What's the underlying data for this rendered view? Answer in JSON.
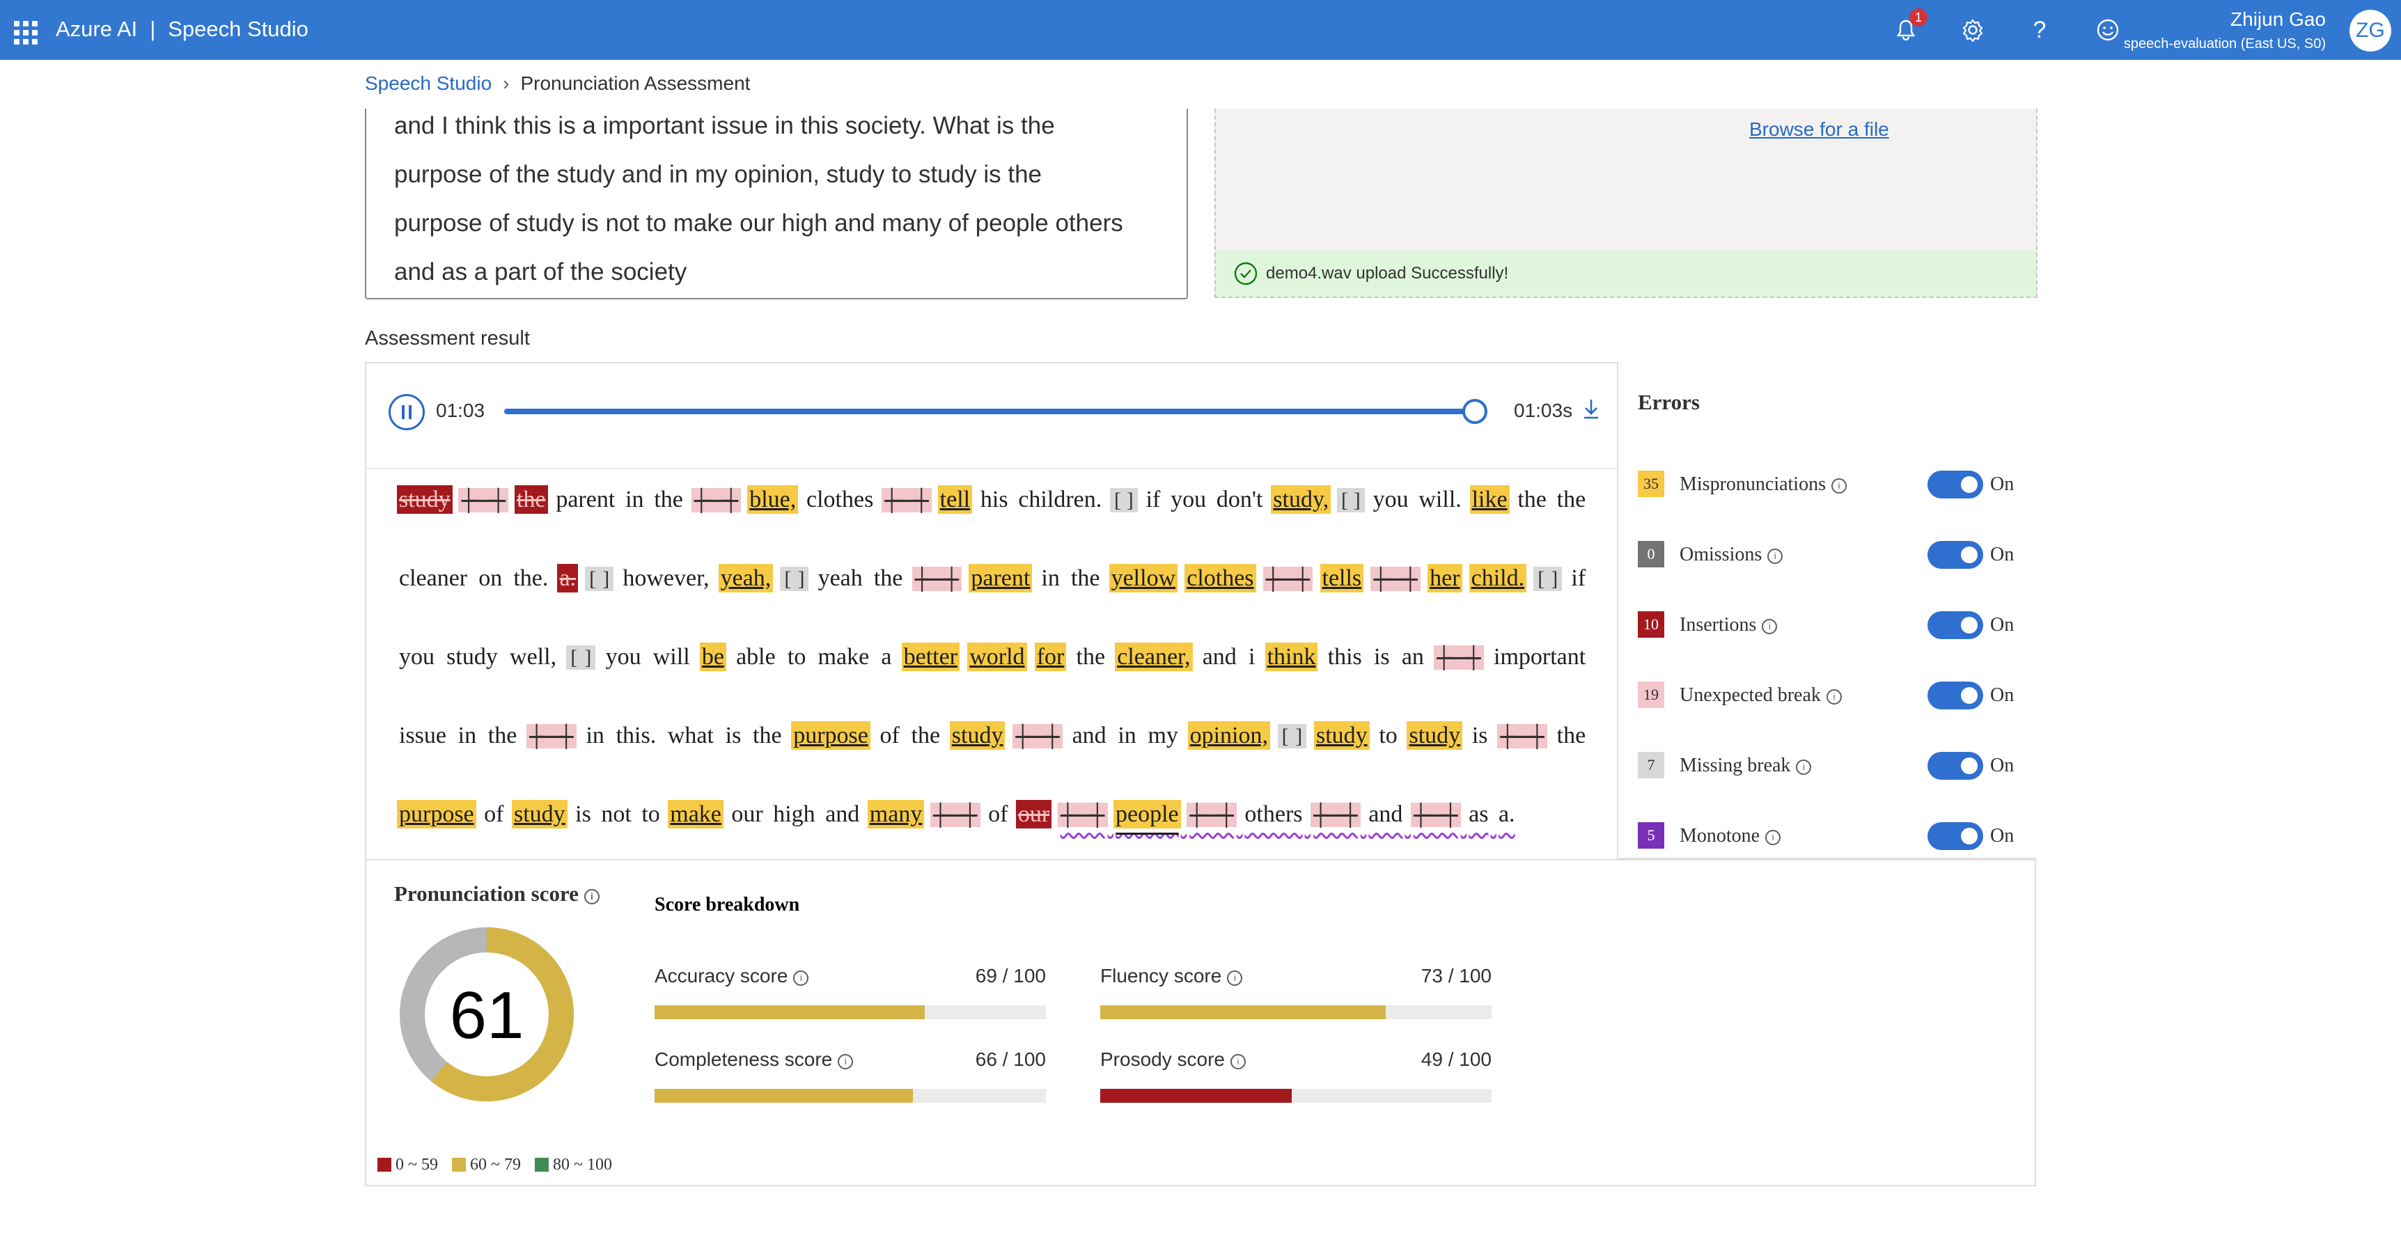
{
  "app": {
    "brand": "Azure AI",
    "product": "Speech Studio",
    "notification_count": "1",
    "user_name": "Zhijun Gao",
    "user_resource": "speech-evaluation (East US, S0)",
    "user_initials": "ZG"
  },
  "breadcrumb": {
    "root": "Speech Studio",
    "current": "Pronunciation Assessment"
  },
  "reference_text": {
    "lines": [
      "and I think this is a important issue in this society. What is the",
      "purpose of the study and in my opinion, study to study is the",
      "purpose of study is not to make our high and many of people others",
      "and as a part of the society"
    ]
  },
  "upload": {
    "browse_label": "Browse for a file",
    "status": "demo4.wav upload Successfully!"
  },
  "assessment": {
    "section_title": "Assessment result",
    "time_current": "01:03",
    "time_total": "01:03s",
    "playback_progress": 1.0
  },
  "transcript": [
    {
      "t": "study",
      "k": "ins"
    },
    {
      "t": "",
      "k": "ub"
    },
    {
      "t": "the",
      "k": "ins"
    },
    {
      "t": "parent",
      "k": "n"
    },
    {
      "t": "in",
      "k": "n"
    },
    {
      "t": "the",
      "k": "n"
    },
    {
      "t": "",
      "k": "ub"
    },
    {
      "t": "blue,",
      "k": "mis"
    },
    {
      "t": "clothes",
      "k": "n"
    },
    {
      "t": "",
      "k": "ub"
    },
    {
      "t": "tell",
      "k": "mis"
    },
    {
      "t": "his",
      "k": "n"
    },
    {
      "t": "children.",
      "k": "n"
    },
    {
      "t": "[ ]",
      "k": "mb"
    },
    {
      "t": "if",
      "k": "n"
    },
    {
      "t": "you",
      "k": "n"
    },
    {
      "t": "don't",
      "k": "n"
    },
    {
      "t": "study,",
      "k": "mis"
    },
    {
      "t": "[ ]",
      "k": "mb"
    },
    {
      "t": "you",
      "k": "n"
    },
    {
      "t": "will.",
      "k": "n"
    },
    {
      "t": "like",
      "k": "mis"
    },
    {
      "t": "the",
      "k": "n"
    },
    {
      "t": "the",
      "k": "n"
    },
    {
      "t": "cleaner",
      "k": "n"
    },
    {
      "t": "on",
      "k": "n"
    },
    {
      "t": "the.",
      "k": "n"
    },
    {
      "t": "a.",
      "k": "ins"
    },
    {
      "t": "[ ]",
      "k": "mb"
    },
    {
      "t": "however,",
      "k": "n"
    },
    {
      "t": "yeah,",
      "k": "mis"
    },
    {
      "t": "[ ]",
      "k": "mb"
    },
    {
      "t": "yeah",
      "k": "n"
    },
    {
      "t": "the",
      "k": "n"
    },
    {
      "t": "",
      "k": "ub"
    },
    {
      "t": "parent",
      "k": "mis"
    },
    {
      "t": "in",
      "k": "n"
    },
    {
      "t": "the",
      "k": "n"
    },
    {
      "t": "yellow",
      "k": "mis"
    },
    {
      "t": "clothes",
      "k": "mis"
    },
    {
      "t": "",
      "k": "ub"
    },
    {
      "t": "tells",
      "k": "mis"
    },
    {
      "t": "",
      "k": "ub"
    },
    {
      "t": "her",
      "k": "mis"
    },
    {
      "t": "child.",
      "k": "mis"
    },
    {
      "t": "[ ]",
      "k": "mb"
    },
    {
      "t": "if",
      "k": "n"
    },
    {
      "t": "you",
      "k": "n"
    },
    {
      "t": "study",
      "k": "n"
    },
    {
      "t": "well,",
      "k": "n"
    },
    {
      "t": "[ ]",
      "k": "mb"
    },
    {
      "t": "you",
      "k": "n"
    },
    {
      "t": "will",
      "k": "n"
    },
    {
      "t": "be",
      "k": "mis"
    },
    {
      "t": "able",
      "k": "n"
    },
    {
      "t": "to",
      "k": "n"
    },
    {
      "t": "make",
      "k": "n"
    },
    {
      "t": "a",
      "k": "n"
    },
    {
      "t": "better",
      "k": "mis"
    },
    {
      "t": "world",
      "k": "mis"
    },
    {
      "t": "for",
      "k": "mis"
    },
    {
      "t": "the",
      "k": "n"
    },
    {
      "t": "cleaner,",
      "k": "mis"
    },
    {
      "t": "and",
      "k": "n"
    },
    {
      "t": "i",
      "k": "n"
    },
    {
      "t": "think",
      "k": "mis"
    },
    {
      "t": "this",
      "k": "n"
    },
    {
      "t": "is",
      "k": "n"
    },
    {
      "t": "an",
      "k": "n"
    },
    {
      "t": "",
      "k": "ub"
    },
    {
      "t": "important",
      "k": "n"
    },
    {
      "t": "issue",
      "k": "n"
    },
    {
      "t": "in",
      "k": "n"
    },
    {
      "t": "the",
      "k": "n"
    },
    {
      "t": "",
      "k": "ub"
    },
    {
      "t": "in",
      "k": "n"
    },
    {
      "t": "this.",
      "k": "n"
    },
    {
      "t": "what",
      "k": "n"
    },
    {
      "t": "is",
      "k": "n"
    },
    {
      "t": "the",
      "k": "n"
    },
    {
      "t": "purpose",
      "k": "mis"
    },
    {
      "t": "of",
      "k": "n"
    },
    {
      "t": "the",
      "k": "n"
    },
    {
      "t": "study",
      "k": "mis"
    },
    {
      "t": "",
      "k": "ub"
    },
    {
      "t": "and",
      "k": "n"
    },
    {
      "t": "in",
      "k": "n"
    },
    {
      "t": "my",
      "k": "n"
    },
    {
      "t": "opinion,",
      "k": "mis"
    },
    {
      "t": "[ ]",
      "k": "mb"
    },
    {
      "t": "study",
      "k": "mis"
    },
    {
      "t": "to",
      "k": "n"
    },
    {
      "t": "study",
      "k": "mis"
    },
    {
      "t": "is",
      "k": "n"
    },
    {
      "t": "",
      "k": "ub"
    },
    {
      "t": "the",
      "k": "n"
    },
    {
      "t": "purpose",
      "k": "mis"
    },
    {
      "t": "of",
      "k": "n"
    },
    {
      "t": "study",
      "k": "mis"
    },
    {
      "t": "is",
      "k": "n"
    },
    {
      "t": "not",
      "k": "n"
    },
    {
      "t": "to",
      "k": "n"
    },
    {
      "t": "make",
      "k": "mis"
    },
    {
      "t": "our",
      "k": "n"
    },
    {
      "t": "high",
      "k": "n"
    },
    {
      "t": "and",
      "k": "n"
    },
    {
      "t": "many",
      "k": "mis"
    },
    {
      "t": "",
      "k": "ub"
    },
    {
      "t": "of",
      "k": "n"
    },
    {
      "t": "our",
      "k": "ins"
    },
    {
      "t": "",
      "k": "ub",
      "m": 1
    },
    {
      "t": "people",
      "k": "mis",
      "m": 1
    },
    {
      "t": "",
      "k": "ub",
      "m": 1
    },
    {
      "t": "others",
      "k": "n",
      "m": 1
    },
    {
      "t": "",
      "k": "ub",
      "m": 1
    },
    {
      "t": "and",
      "k": "n",
      "m": 1
    },
    {
      "t": "",
      "k": "ub",
      "m": 1
    },
    {
      "t": "as",
      "k": "n",
      "m": 1
    },
    {
      "t": "a.",
      "k": "n",
      "m": 1
    }
  ],
  "errors": {
    "title": "Errors",
    "toggle_label": "On",
    "items": [
      {
        "count": "35",
        "label": "Mispronunciations",
        "color": "#f6ca45",
        "text_color": "#323130",
        "enabled": true
      },
      {
        "count": "0",
        "label": "Omissions",
        "color": "#737373",
        "text_color": "#ffffff",
        "enabled": true
      },
      {
        "count": "10",
        "label": "Insertions",
        "color": "#a4191d",
        "text_color": "#ffffff",
        "enabled": true
      },
      {
        "count": "19",
        "label": "Unexpected break",
        "color": "#f2c6cb",
        "text_color": "#323130",
        "enabled": true
      },
      {
        "count": "7",
        "label": "Missing break",
        "color": "#d8d8d8",
        "text_color": "#323130",
        "enabled": true
      },
      {
        "count": "5",
        "label": "Monotone",
        "color": "#7a2fb8",
        "text_color": "#ffffff",
        "enabled": true
      }
    ]
  },
  "pronunciation": {
    "title": "Pronunciation score",
    "score": "61",
    "score_value": 61,
    "breakdown_title": "Score breakdown",
    "scores": [
      {
        "label": "Accuracy score",
        "value": 69,
        "max": 100,
        "display": "69 / 100",
        "color": "#d4b447"
      },
      {
        "label": "Fluency score",
        "value": 73,
        "max": 100,
        "display": "73 / 100",
        "color": "#d4b447"
      },
      {
        "label": "Completeness score",
        "value": 66,
        "max": 100,
        "display": "66 / 100",
        "color": "#d4b447"
      },
      {
        "label": "Prosody score",
        "value": 49,
        "max": 100,
        "display": "49 / 100",
        "color": "#a4191d"
      }
    ],
    "legend": [
      {
        "label": "0 ~ 59",
        "color": "#a4191d"
      },
      {
        "label": "60 ~ 79",
        "color": "#d4b447"
      },
      {
        "label": "80 ~ 100",
        "color": "#3f8a56"
      }
    ],
    "donut_colors": {
      "score": "#d4b447",
      "remainder": "#b7b7b7"
    }
  }
}
